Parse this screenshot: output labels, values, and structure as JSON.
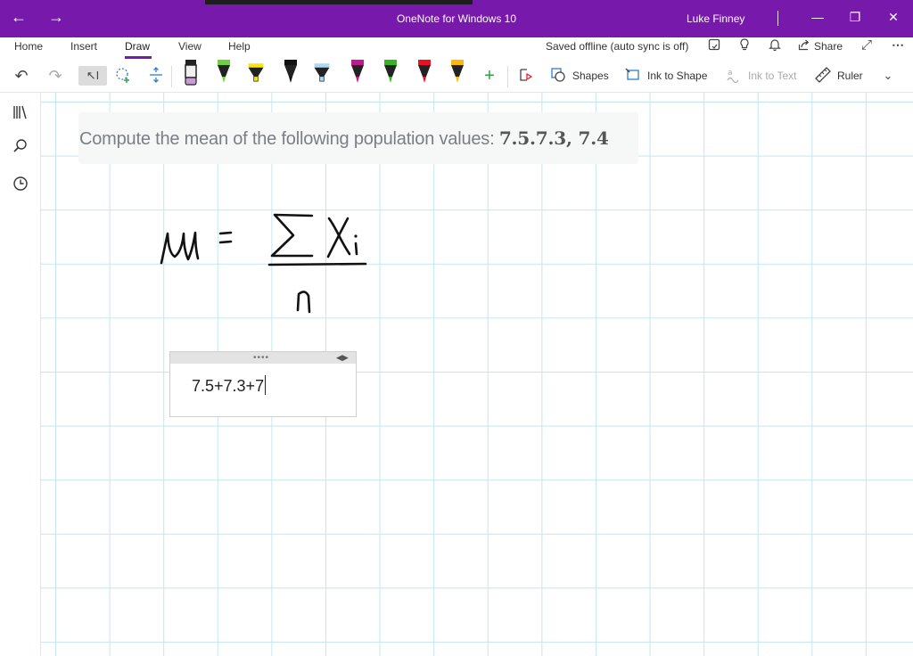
{
  "titlebar": {
    "back_icon": "arrow-left-icon",
    "forward_icon": "arrow-right-icon",
    "app_title": "OneNote for Windows 10",
    "user_name": "Luke Finney",
    "color": "#7719aa"
  },
  "ribbon": {
    "tabs": [
      {
        "label": "Home"
      },
      {
        "label": "Insert"
      },
      {
        "label": "Draw",
        "active": true
      },
      {
        "label": "View"
      },
      {
        "label": "Help"
      }
    ],
    "sync_status": "Saved offline (auto sync is off)",
    "share_label": "Share"
  },
  "toolbar": {
    "shapes_label": "Shapes",
    "ink_to_shape_label": "Ink to Shape",
    "ink_to_text_label": "Ink to Text",
    "ruler_label": "Ruler",
    "pens": [
      {
        "name": "pen-pink",
        "color": "#c89ad6"
      },
      {
        "name": "pen-green-1",
        "color": "#6fd13c"
      },
      {
        "name": "highlighter-yellow",
        "color": "#ffe600"
      },
      {
        "name": "pen-black",
        "color": "#111111"
      },
      {
        "name": "highlighter-blue",
        "color": "#a9dcf4"
      },
      {
        "name": "pen-magenta",
        "color": "#c2188f"
      },
      {
        "name": "pen-green-2",
        "color": "#36b424"
      },
      {
        "name": "pen-red",
        "color": "#e81224"
      },
      {
        "name": "pen-orange",
        "color": "#ffb900"
      }
    ]
  },
  "page": {
    "question_prefix": "Compute the mean of the following population values: ",
    "question_values": "7.5.7.3, 7.4",
    "textbox_content": "7.5+7.3+7",
    "ink_color": "#111111",
    "grid_color": "#c4e6f1"
  }
}
